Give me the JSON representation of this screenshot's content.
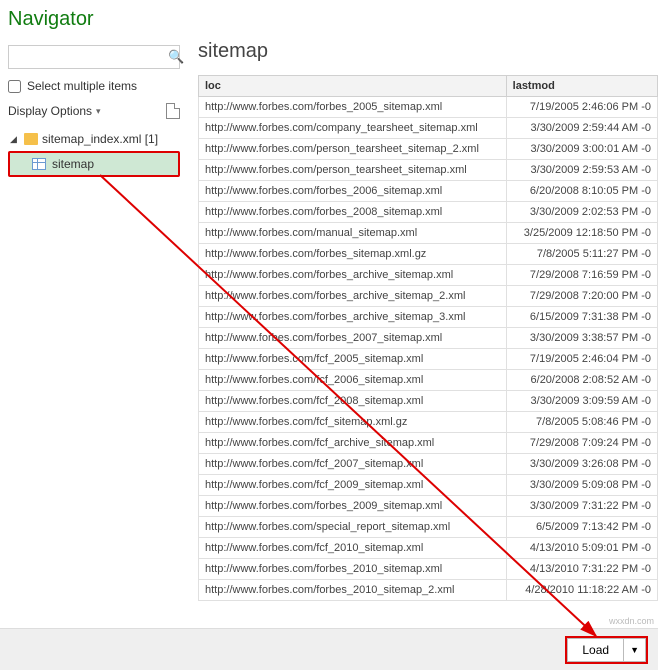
{
  "nav": {
    "title": "Navigator",
    "search_placeholder": "",
    "select_multiple_label": "Select multiple items",
    "display_options_label": "Display Options",
    "tree_root": "sitemap_index.xml [1]",
    "tree_child": "sitemap"
  },
  "preview": {
    "title": "sitemap",
    "cols": {
      "loc": "loc",
      "lastmod": "lastmod"
    },
    "rows": [
      {
        "loc": "http://www.forbes.com/forbes_2005_sitemap.xml",
        "lastmod": "7/19/2005 2:46:06 PM -0"
      },
      {
        "loc": "http://www.forbes.com/company_tearsheet_sitemap.xml",
        "lastmod": "3/30/2009 2:59:44 AM -0"
      },
      {
        "loc": "http://www.forbes.com/person_tearsheet_sitemap_2.xml",
        "lastmod": "3/30/2009 3:00:01 AM -0"
      },
      {
        "loc": "http://www.forbes.com/person_tearsheet_sitemap.xml",
        "lastmod": "3/30/2009 2:59:53 AM -0"
      },
      {
        "loc": "http://www.forbes.com/forbes_2006_sitemap.xml",
        "lastmod": "6/20/2008 8:10:05 PM -0"
      },
      {
        "loc": "http://www.forbes.com/forbes_2008_sitemap.xml",
        "lastmod": "3/30/2009 2:02:53 PM -0"
      },
      {
        "loc": "http://www.forbes.com/manual_sitemap.xml",
        "lastmod": "3/25/2009 12:18:50 PM -0"
      },
      {
        "loc": "http://www.forbes.com/forbes_sitemap.xml.gz",
        "lastmod": "7/8/2005 5:11:27 PM -0"
      },
      {
        "loc": "http://www.forbes.com/forbes_archive_sitemap.xml",
        "lastmod": "7/29/2008 7:16:59 PM -0"
      },
      {
        "loc": "http://www.forbes.com/forbes_archive_sitemap_2.xml",
        "lastmod": "7/29/2008 7:20:00 PM -0"
      },
      {
        "loc": "http://www.forbes.com/forbes_archive_sitemap_3.xml",
        "lastmod": "6/15/2009 7:31:38 PM -0"
      },
      {
        "loc": "http://www.forbes.com/forbes_2007_sitemap.xml",
        "lastmod": "3/30/2009 3:38:57 PM -0"
      },
      {
        "loc": "http://www.forbes.com/fcf_2005_sitemap.xml",
        "lastmod": "7/19/2005 2:46:04 PM -0"
      },
      {
        "loc": "http://www.forbes.com/fcf_2006_sitemap.xml",
        "lastmod": "6/20/2008 2:08:52 AM -0"
      },
      {
        "loc": "http://www.forbes.com/fcf_2008_sitemap.xml",
        "lastmod": "3/30/2009 3:09:59 AM -0"
      },
      {
        "loc": "http://www.forbes.com/fcf_sitemap.xml.gz",
        "lastmod": "7/8/2005 5:08:46 PM -0"
      },
      {
        "loc": "http://www.forbes.com/fcf_archive_sitemap.xml",
        "lastmod": "7/29/2008 7:09:24 PM -0"
      },
      {
        "loc": "http://www.forbes.com/fcf_2007_sitemap.xml",
        "lastmod": "3/30/2009 3:26:08 PM -0"
      },
      {
        "loc": "http://www.forbes.com/fcf_2009_sitemap.xml",
        "lastmod": "3/30/2009 5:09:08 PM -0"
      },
      {
        "loc": "http://www.forbes.com/forbes_2009_sitemap.xml",
        "lastmod": "3/30/2009 7:31:22 PM -0"
      },
      {
        "loc": "http://www.forbes.com/special_report_sitemap.xml",
        "lastmod": "6/5/2009 7:13:42 PM -0"
      },
      {
        "loc": "http://www.forbes.com/fcf_2010_sitemap.xml",
        "lastmod": "4/13/2010 5:09:01 PM -0"
      },
      {
        "loc": "http://www.forbes.com/forbes_2010_sitemap.xml",
        "lastmod": "4/13/2010 7:31:22 PM -0"
      },
      {
        "loc": "http://www.forbes.com/forbes_2010_sitemap_2.xml",
        "lastmod": "4/28/2010 11:18:22 AM -0"
      }
    ]
  },
  "footer": {
    "load_label": "Load"
  },
  "watermark": "wxxdn.com"
}
